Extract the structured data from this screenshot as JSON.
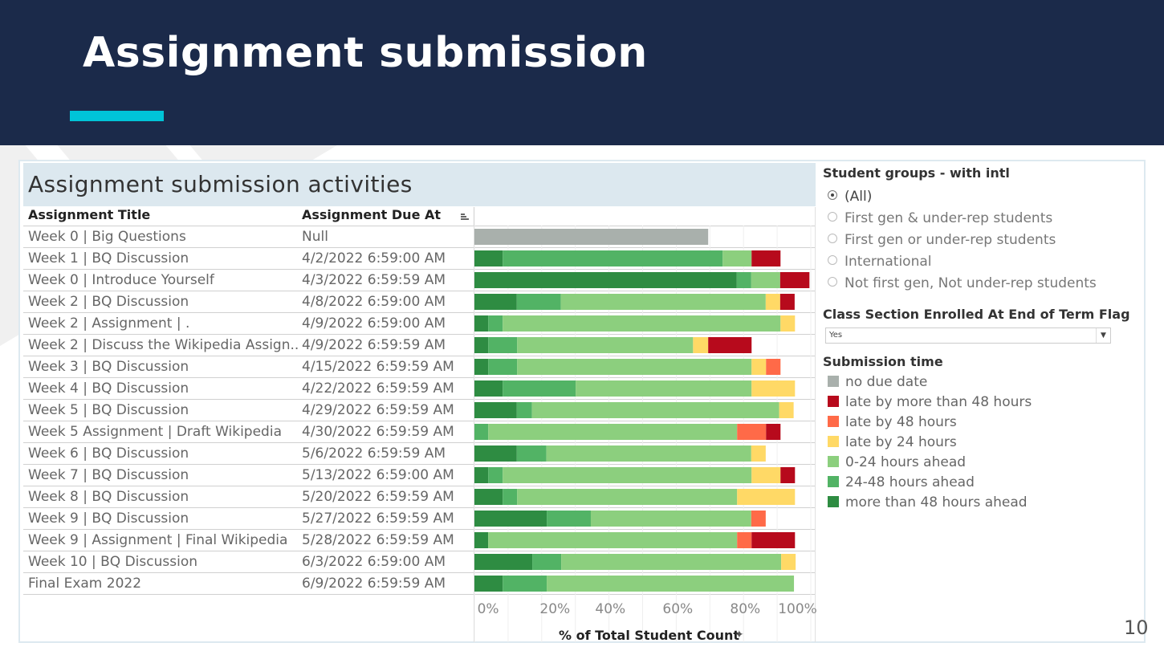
{
  "slide": {
    "title": "Assignment submission",
    "page_number": "10"
  },
  "viz": {
    "title": "Assignment submission activities",
    "columns": {
      "title": "Assignment Title",
      "due": "Assignment Due At"
    }
  },
  "filters": {
    "student_groups": {
      "label": "Student groups - with intl",
      "options": [
        {
          "label": "(All)",
          "selected": true
        },
        {
          "label": "First gen & under-rep students",
          "selected": false
        },
        {
          "label": "First gen or under-rep students",
          "selected": false
        },
        {
          "label": "International",
          "selected": false
        },
        {
          "label": "Not first gen, Not under-rep students",
          "selected": false
        }
      ]
    },
    "enrolled_flag": {
      "label": "Class Section Enrolled At End of Term Flag",
      "value": "Yes"
    }
  },
  "legend": {
    "title": "Submission time",
    "items": [
      {
        "key": "no_due",
        "label": "no due date",
        "color": "#a9b0ac"
      },
      {
        "key": "late_gt48",
        "label": "late by more than 48 hours",
        "color": "#b70a1c"
      },
      {
        "key": "late_48",
        "label": "late by 48 hours",
        "color": "#ff6a48"
      },
      {
        "key": "late_24",
        "label": "late by 24 hours",
        "color": "#ffd966"
      },
      {
        "key": "ahead_0_24",
        "label": "0-24 hours ahead",
        "color": "#8ccf7e"
      },
      {
        "key": "ahead_24_48",
        "label": "24-48 hours ahead",
        "color": "#52b365"
      },
      {
        "key": "ahead_gt48",
        "label": "more than 48 hours ahead",
        "color": "#2e8c42"
      }
    ]
  },
  "chart_data": {
    "type": "bar",
    "orientation": "horizontal-stacked",
    "xlabel": "% of Total Student Count",
    "xlim": [
      0,
      100
    ],
    "x_ticks": [
      "0%",
      "20%",
      "40%",
      "60%",
      "80%",
      "100%"
    ],
    "grid": true,
    "legend_position": "right",
    "stack_order": [
      "ahead_gt48",
      "ahead_24_48",
      "ahead_0_24",
      "late_24",
      "late_48",
      "late_gt48",
      "no_due"
    ],
    "rows": [
      {
        "title": "Week 0 | Big Questions",
        "due": "Null",
        "values": {
          "no_due": 69.5
        }
      },
      {
        "title": "Week 1 | BQ Discussion",
        "due": "4/2/2022 6:59:00 AM",
        "values": {
          "ahead_gt48": 8.4,
          "ahead_24_48": 65.4,
          "ahead_0_24": 8.6,
          "late_gt48": 8.6
        }
      },
      {
        "title": "Week 0 | Introduce Yourself",
        "due": "4/3/2022 6:59:59 AM",
        "values": {
          "ahead_gt48": 78.0,
          "ahead_24_48": 4.3,
          "ahead_0_24": 8.6,
          "late_gt48": 8.7
        }
      },
      {
        "title": "Week 2 | BQ Discussion",
        "due": "4/8/2022 6:59:00 AM",
        "values": {
          "ahead_gt48": 12.6,
          "ahead_24_48": 13.1,
          "ahead_0_24": 60.9,
          "late_24": 4.3,
          "late_gt48": 4.3
        }
      },
      {
        "title": "Week 2 | Assignment |                        .",
        "due": "4/9/2022 6:59:00 AM",
        "values": {
          "ahead_gt48": 4.1,
          "ahead_24_48": 4.3,
          "ahead_0_24": 82.6,
          "late_24": 4.3
        }
      },
      {
        "title": "Week 2 | Discuss the Wikipedia Assign..",
        "due": "4/9/2022 6:59:59 AM",
        "values": {
          "ahead_gt48": 4.1,
          "ahead_24_48": 8.6,
          "ahead_0_24": 52.3,
          "late_24": 4.5,
          "late_gt48": 12.9
        }
      },
      {
        "title": "Week 3 | BQ Discussion",
        "due": "4/15/2022 6:59:59 AM",
        "values": {
          "ahead_gt48": 4.1,
          "ahead_24_48": 8.6,
          "ahead_0_24": 69.7,
          "late_24": 4.3,
          "late_48": 4.3
        }
      },
      {
        "title": "Week 4 | BQ Discussion",
        "due": "4/22/2022 6:59:59 AM",
        "values": {
          "ahead_gt48": 8.4,
          "ahead_24_48": 21.7,
          "ahead_0_24": 52.3,
          "late_24": 12.9
        }
      },
      {
        "title": "Week 5 | BQ Discussion",
        "due": "4/29/2022 6:59:59 AM",
        "values": {
          "ahead_gt48": 12.6,
          "ahead_24_48": 4.5,
          "ahead_0_24": 73.5,
          "late_24": 4.3
        }
      },
      {
        "title": "Week 5 Assignment | Draft Wikipedia",
        "due": "4/30/2022 6:59:59 AM",
        "values": {
          "ahead_24_48": 4.1,
          "ahead_0_24": 74.0,
          "late_48": 8.6,
          "late_gt48": 4.3
        }
      },
      {
        "title": "Week 6 | BQ Discussion",
        "due": "5/6/2022 6:59:59 AM",
        "values": {
          "ahead_gt48": 12.6,
          "ahead_24_48": 8.8,
          "ahead_0_24": 60.9,
          "late_24": 4.3
        }
      },
      {
        "title": "Week 7 | BQ Discussion",
        "due": "5/13/2022 6:59:00 AM",
        "values": {
          "ahead_gt48": 4.1,
          "ahead_24_48": 4.3,
          "ahead_0_24": 74.0,
          "late_24": 8.6,
          "late_gt48": 4.3
        }
      },
      {
        "title": "Week 8 | BQ Discussion",
        "due": "5/20/2022 6:59:59 AM",
        "values": {
          "ahead_gt48": 8.4,
          "ahead_24_48": 4.3,
          "ahead_0_24": 65.4,
          "late_24": 17.2
        }
      },
      {
        "title": "Week 9 | BQ Discussion",
        "due": "5/27/2022 6:59:59 AM",
        "values": {
          "ahead_gt48": 21.5,
          "ahead_24_48": 13.1,
          "ahead_0_24": 47.7,
          "late_48": 4.3
        }
      },
      {
        "title": "Week 9 | Assignment | Final Wikipedia",
        "due": "5/28/2022 6:59:59 AM",
        "values": {
          "ahead_gt48": 4.1,
          "ahead_0_24": 74.0,
          "late_48": 4.3,
          "late_gt48": 12.9
        }
      },
      {
        "title": "Week 10 | BQ Discussion",
        "due": "6/3/2022 6:59:00 AM",
        "values": {
          "ahead_gt48": 17.2,
          "ahead_24_48": 8.6,
          "ahead_0_24": 65.4,
          "late_24": 4.3
        }
      },
      {
        "title": "Final Exam 2022",
        "due": "6/9/2022 6:59:59 AM",
        "values": {
          "ahead_gt48": 8.4,
          "ahead_24_48": 13.1,
          "ahead_0_24": 73.5
        }
      }
    ]
  }
}
